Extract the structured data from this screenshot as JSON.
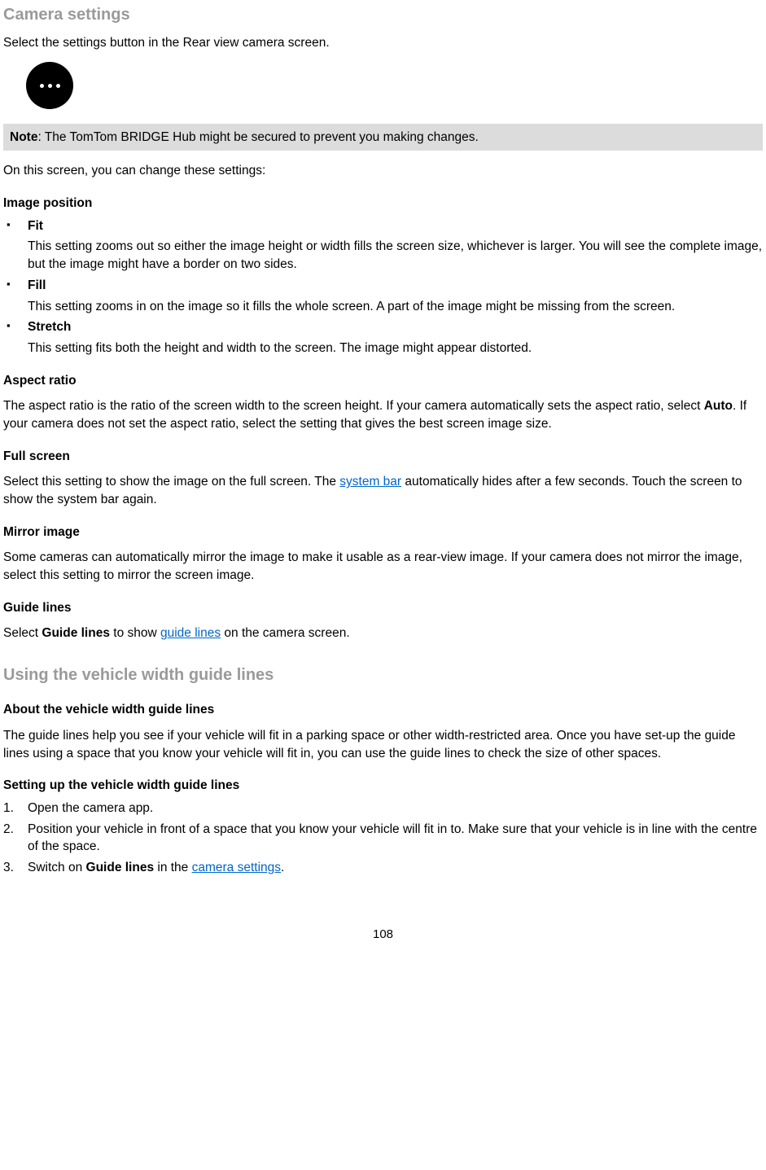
{
  "section1": {
    "title": "Camera settings",
    "intro": "Select the settings button in the Rear view camera screen.",
    "icon_name": "settings-dots-icon",
    "note_label": "Note",
    "note_text": ": The TomTom BRIDGE Hub might be secured to prevent you making changes.",
    "lead": "On this screen, you can change these settings:",
    "image_position": {
      "heading": "Image position",
      "items": [
        {
          "title": "Fit",
          "desc": "This setting zooms out so either the image height or width fills the screen size, whichever is larger. You will see the complete image, but the image might have a border on two sides."
        },
        {
          "title": "Fill",
          "desc": "This setting zooms in on the image so it fills the whole screen. A part of the image might be missing from the screen."
        },
        {
          "title": "Stretch",
          "desc": "This setting fits both the height and width to the screen. The image might appear distorted."
        }
      ]
    },
    "aspect_ratio": {
      "heading": "Aspect ratio",
      "text_before_auto": "The aspect ratio is the ratio of the screen width to the screen height. If your camera automatically sets the aspect ratio, select ",
      "auto": "Auto",
      "text_after_auto": ". If your camera does not set the aspect ratio, select the setting that gives the best screen image size."
    },
    "full_screen": {
      "heading": "Full screen",
      "text_before_link": "Select this setting to show the image on the full screen. The ",
      "link": "system bar",
      "text_after_link": " automatically hides after a few seconds. Touch the screen to show the system bar again."
    },
    "mirror": {
      "heading": "Mirror image",
      "text": "Some cameras can automatically mirror the image to make it usable as a rear-view image. If your camera does not mirror the image, select this setting to mirror the screen image."
    },
    "guide_lines": {
      "heading": "Guide lines",
      "text_before_bold": "Select ",
      "bold": "Guide lines",
      "text_mid": " to show ",
      "link": "guide lines",
      "text_after": " on the camera screen."
    }
  },
  "section2": {
    "title": "Using the vehicle width guide lines",
    "about": {
      "heading": "About the vehicle width guide lines",
      "text": "The guide lines help you see if your vehicle will fit in a parking space or other width-restricted area. Once you have set-up the guide lines using a space that you know your vehicle will fit in, you can use the guide lines to check the size of other spaces."
    },
    "setup": {
      "heading": "Setting up the vehicle width guide lines",
      "steps": [
        {
          "text": "Open the camera app."
        },
        {
          "text": "Position your vehicle in front of a space that you know your vehicle will fit in to. Make sure that your vehicle is in line with the centre of the space."
        },
        {
          "before_bold": "Switch on ",
          "bold": "Guide lines",
          "mid": " in the ",
          "link": "camera settings",
          "after": "."
        }
      ]
    }
  },
  "page_number": "108"
}
